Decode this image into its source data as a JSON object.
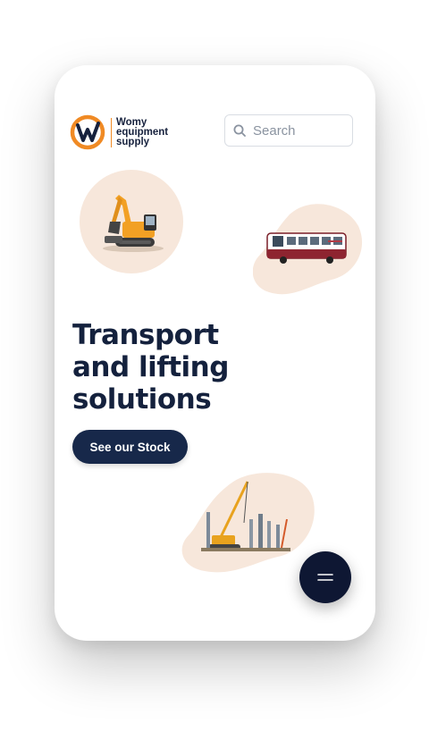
{
  "brand": {
    "logo_lines": [
      "Womy",
      "equipment",
      "supply"
    ],
    "logo_icon": "wes-logo-icon",
    "accent_color": "#f08a24",
    "primary_color": "#16213d"
  },
  "search": {
    "placeholder": "Search",
    "icon": "search-icon"
  },
  "hero": {
    "title_lines": [
      "Transport",
      "and lifting",
      "solutions"
    ]
  },
  "cta": {
    "label": "See our Stock"
  },
  "fab": {
    "icon": "menu-icon",
    "color": "#0e1733"
  },
  "images": [
    {
      "name": "excavator-image",
      "background": "#f7e7db"
    },
    {
      "name": "bus-image",
      "background": "#f7e7db"
    },
    {
      "name": "crane-image",
      "background": "#f7e7db"
    }
  ]
}
